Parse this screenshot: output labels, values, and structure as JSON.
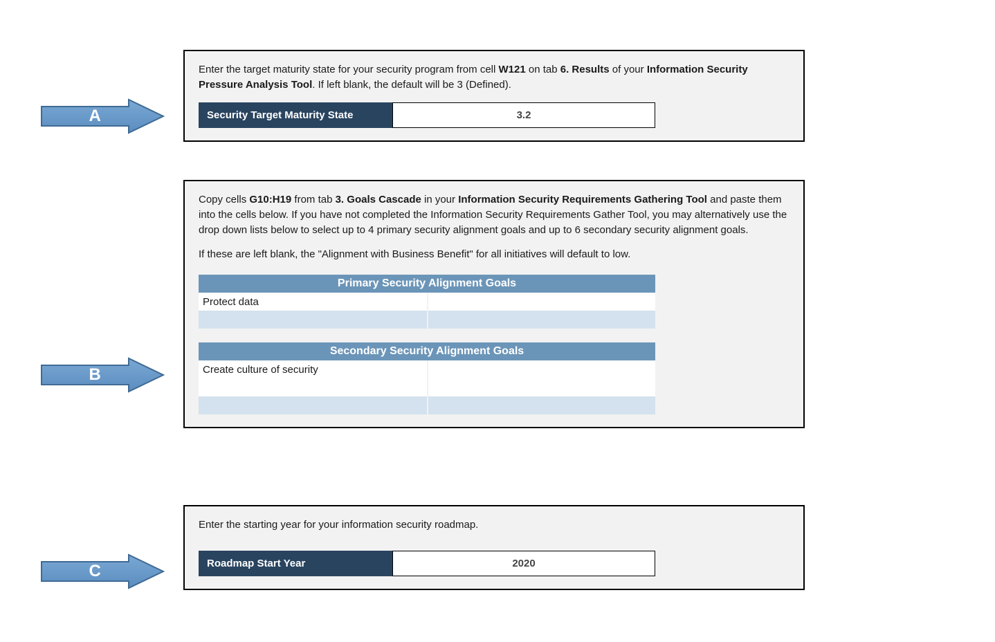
{
  "colors": {
    "arrow_fill_start": "#7aa8d4",
    "arrow_fill_end": "#5b8dc0",
    "arrow_stroke": "#3f6a94",
    "panel_bg": "#f2f2f2",
    "panel_border": "#000000",
    "dark_label_bg": "#29445f",
    "table_header_bg": "#6b95b8",
    "table_alt_bg": "#d4e1ee"
  },
  "arrows": {
    "a": "A",
    "b": "B",
    "c": "C"
  },
  "panelA": {
    "instruction_pre": "Enter the target maturity state for your security program from cell ",
    "cell_ref": "W121",
    "mid1": " on tab ",
    "tab_ref": "6. Results",
    "mid2": " of your ",
    "tool_ref": "Information Security Pressure Analysis Tool",
    "post": ". If left blank, the default will be 3 (Defined).",
    "label": "Security Target Maturity State",
    "value": "3.2"
  },
  "panelB": {
    "p1_pre": "Copy cells ",
    "cells_ref": "G10:H19",
    "p1_mid1": " from tab ",
    "tab_ref": "3. Goals Cascade ",
    "p1_mid2": " in your ",
    "tool_ref": "Information Security Requirements Gathering Tool",
    "p1_post": " and paste them into the cells below. If you have not completed the Information Security Requirements Gather Tool, you may alternatively use the drop down lists below to select up to 4 primary security alignment goals and up to 6 secondary security alignment goals.",
    "p2": "If these are left blank, the \"Alignment with Business Benefit\" for all initiatives will default to low.",
    "primary_header": "Primary Security Alignment Goals",
    "primary_rows": [
      {
        "left": "Protect data",
        "right": ""
      },
      {
        "left": "",
        "right": ""
      }
    ],
    "secondary_header": "Secondary Security Alignment Goals",
    "secondary_rows": [
      {
        "left": "Create culture of security",
        "right": ""
      },
      {
        "left": "",
        "right": ""
      },
      {
        "left": "",
        "right": ""
      }
    ]
  },
  "panelC": {
    "instruction": "Enter the starting year for your information security roadmap.",
    "label": "Roadmap Start Year",
    "value": "2020"
  }
}
